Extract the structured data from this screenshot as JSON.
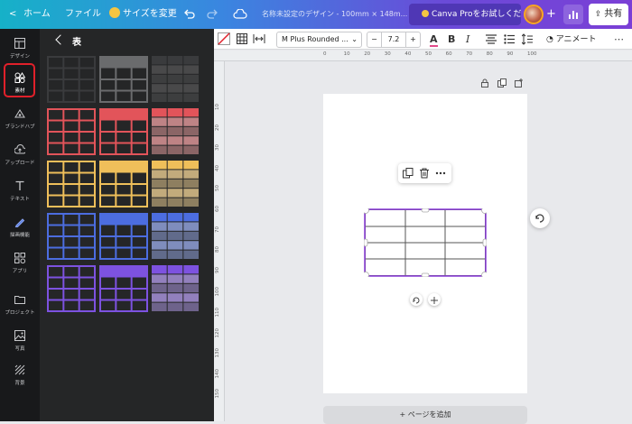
{
  "topbar": {
    "back_glyph": "<",
    "home_label": "ホーム",
    "file_label": "ファイル",
    "resize_label": "サイズを変更",
    "undo_icon": "undo-icon",
    "redo_icon": "redo-icon",
    "cloud_icon": "cloud-saved-icon",
    "design_title": "名称未設定のデザイン - 100mm × 148m...",
    "pro_tab_label": "Canva Proをお試しくださ...",
    "add_glyph": "+",
    "share_label": "共有",
    "colors": {
      "gradient_start": "#16b1c8",
      "gradient_end": "#7b3fd6",
      "pro_tab": "#4f37b5"
    }
  },
  "rail": {
    "items": [
      {
        "label": "デザイン",
        "icon": "layout-icon"
      },
      {
        "label": "素材",
        "icon": "shapes-icon",
        "selected": true
      },
      {
        "label": "ブランドハブ",
        "icon": "brand-icon"
      },
      {
        "label": "アップロード",
        "icon": "upload-icon"
      },
      {
        "label": "テキスト",
        "icon": "text-icon"
      },
      {
        "label": "描画機能",
        "icon": "draw-icon"
      },
      {
        "label": "アプリ",
        "icon": "apps-icon"
      },
      {
        "label": "プロジェクト",
        "icon": "folder-icon"
      },
      {
        "label": "写真",
        "icon": "photo-icon"
      },
      {
        "label": "背景",
        "icon": "background-icon"
      }
    ],
    "highlight_color": "#e0202a"
  },
  "panel": {
    "title": "表",
    "table_styles": [
      {
        "row": 0,
        "colors": [
          "#3a3b3d",
          "#6a6b6d",
          "#555657"
        ]
      },
      {
        "row": 1,
        "colors": [
          "#e2545a",
          "#e2545a",
          "#f1a3a6"
        ]
      },
      {
        "row": 2,
        "colors": [
          "#efbf5a",
          "#efbf5a",
          "#f7d89a"
        ]
      },
      {
        "row": 3,
        "colors": [
          "#4c6de0",
          "#4c6de0",
          "#9db0f0"
        ]
      },
      {
        "row": 4,
        "colors": [
          "#7d52e0",
          "#7d52e0",
          "#b79ff0"
        ]
      }
    ]
  },
  "toolbar": {
    "font_name": "M Plus Rounded ...",
    "font_size_minus": "−",
    "font_size": "7.2",
    "font_size_plus": "+",
    "text_color_glyph": "A",
    "bold_glyph": "B",
    "italic_glyph": "I",
    "animate_label": "アニメート"
  },
  "rulers": {
    "h_ticks": [
      "0",
      "10",
      "20",
      "30",
      "40",
      "50",
      "60",
      "70",
      "80",
      "90",
      "100"
    ],
    "v_ticks": [
      "10",
      "20",
      "30",
      "40",
      "50",
      "60",
      "70",
      "80",
      "90",
      "100",
      "110",
      "120",
      "130",
      "140",
      "150"
    ]
  },
  "canvas": {
    "page_lock_icon": "lock-icon",
    "page_copy_icon": "duplicate-page-icon",
    "page_add_icon": "add-page-icon",
    "selection_color": "#8b3ddb",
    "add_page_label": "+ ページを追加"
  }
}
